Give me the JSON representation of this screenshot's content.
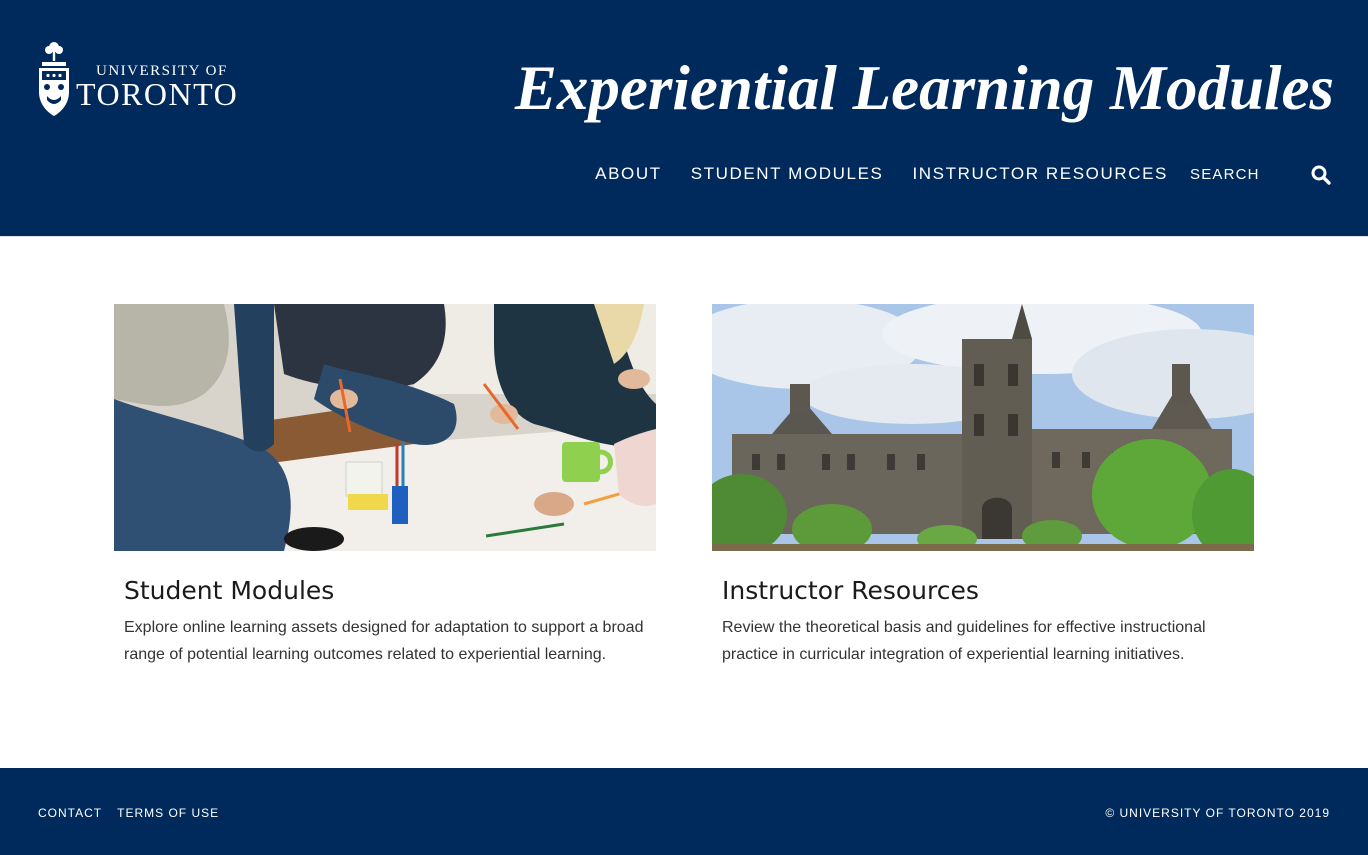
{
  "header": {
    "logo_line1": "UNIVERSITY OF",
    "logo_line2": "TORONTO",
    "title": "Experiential Learning Modules",
    "nav": [
      {
        "label": "ABOUT"
      },
      {
        "label": "STUDENT MODULES"
      },
      {
        "label": "INSTRUCTOR RESOURCES"
      }
    ],
    "search_label": "SEARCH",
    "search_icon": "search-icon"
  },
  "cards": [
    {
      "title": "Student Modules",
      "description": "Explore online learning assets designed for adaptation to support a broad range of potential learning outcomes related to experiential learning.",
      "image": "students-collaborating-photo"
    },
    {
      "title": "Instructor Resources",
      "description": "Review the theoretical basis and guidelines for effective instructional practice in curricular integration of experiential learning initiatives.",
      "image": "university-college-building-photo"
    }
  ],
  "footer": {
    "links": [
      {
        "label": "CONTACT"
      },
      {
        "label": "TERMS OF USE"
      }
    ],
    "copyright": "© UNIVERSITY OF TORONTO 2019"
  },
  "colors": {
    "brand_navy": "#002a5c",
    "background": "#ffffff",
    "text": "#222222"
  }
}
